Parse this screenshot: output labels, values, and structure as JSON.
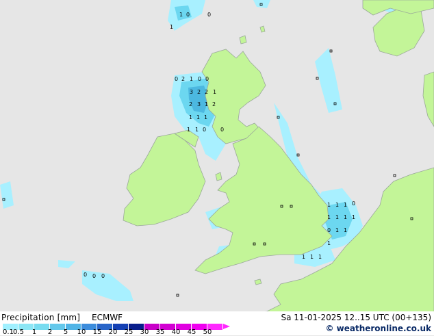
{
  "header": {
    "title": "Precipitation [mm]",
    "model": "ECMWF"
  },
  "footer": {
    "datetime": "Sa 11-01-2025 12..15 UTC (00+135)",
    "credit": "© weatheronline.co.uk"
  },
  "legend": {
    "labels": [
      "0.1",
      "0.5",
      "1",
      "2",
      "5",
      "10",
      "15",
      "20",
      "25",
      "30",
      "35",
      "40",
      "45",
      "50"
    ],
    "colors": [
      "#a0f0ff",
      "#8ce6f5",
      "#78dcf0",
      "#64c8eb",
      "#50b4e6",
      "#3c8cdc",
      "#2864c8",
      "#1440b4",
      "#0a1e8c",
      "#c800c8",
      "#d200d2",
      "#e100e1",
      "#f000f0",
      "#ff28ff"
    ]
  },
  "colors": {
    "sea": "#e6e6e6",
    "land": "#c3f598",
    "coast": "#9aa89a",
    "precip_light": "#a8f0ff",
    "precip_med": "#6cd7f0",
    "precip_heavy": "#4cb8e0"
  },
  "map_values": {
    "top": [
      "1",
      "0",
      "1",
      "0"
    ],
    "scotland_nw": [
      "0",
      "2",
      "1",
      "0",
      "0",
      "3",
      "2",
      "2",
      "1",
      "2",
      "3",
      "1",
      "2",
      "1",
      "1",
      "1",
      "1",
      "1",
      "0"
    ],
    "channel": [
      "1",
      "1",
      "1",
      "0",
      "1",
      "1",
      "1",
      "1",
      "0",
      "1",
      "1",
      "1",
      "1",
      "1",
      "1"
    ],
    "misc": [
      "0",
      "0",
      "0",
      "0"
    ]
  }
}
